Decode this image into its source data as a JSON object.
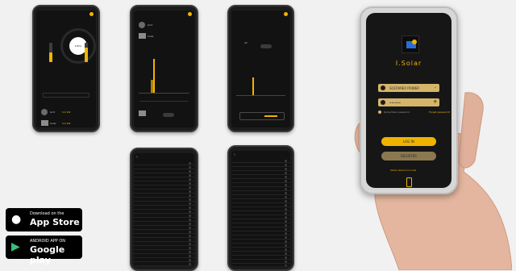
{
  "phones": {
    "dashboard": {
      "gauge_value": "100%",
      "grid_label": "Grid",
      "grid_value": "0.0 kW",
      "solar_label": "Solar",
      "solar_value": "0.0 kW"
    },
    "chart1": {
      "grid_label": "Grid",
      "solar_label": "Solar"
    },
    "chart2": {
      "grid_label": "AC"
    }
  },
  "login": {
    "brand": "I.Solar",
    "username_value": "SOLTAMEX POWER",
    "password_value": "••••••",
    "remember_label": "Remember password",
    "forgot_label": "Forget password?",
    "login_button": "LOG IN",
    "register_button": "REGISTER",
    "footer_link": "Share device to Local"
  },
  "stores": {
    "apple_line1": "Download on the",
    "apple_line2": "App Store",
    "google_line1": "ANDROID APP ON",
    "google_line2": "Google play"
  },
  "colors": {
    "accent": "#f0b400",
    "field": "#d5b56a",
    "phone_bg": "#121212"
  }
}
